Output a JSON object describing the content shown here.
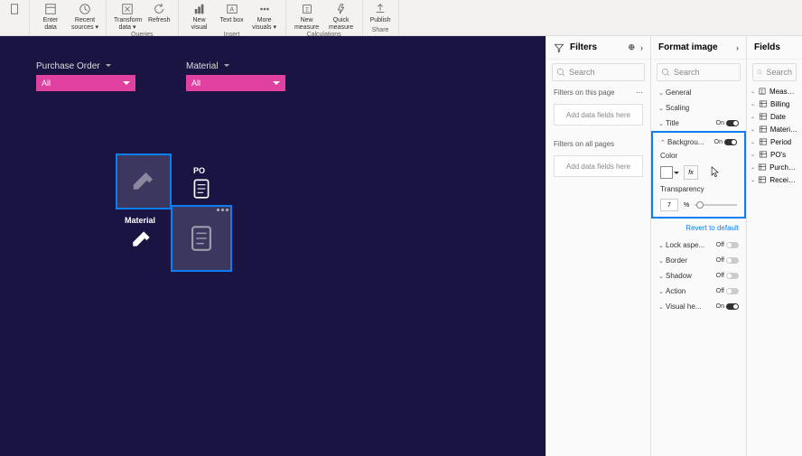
{
  "ribbon": {
    "groups": [
      {
        "label": "",
        "items": [
          {
            "label": ""
          }
        ]
      },
      {
        "label": "",
        "items": [
          {
            "label": "Enter data"
          },
          {
            "label": "Recent sources ▾"
          }
        ]
      },
      {
        "label": "Queries",
        "items": [
          {
            "label": "Transform data ▾"
          },
          {
            "label": "Refresh"
          }
        ]
      },
      {
        "label": "Insert",
        "items": [
          {
            "label": "New visual"
          },
          {
            "label": "Text box"
          },
          {
            "label": "More visuals ▾"
          }
        ]
      },
      {
        "label": "Calculations",
        "items": [
          {
            "label": "New measure"
          },
          {
            "label": "Quick measure"
          }
        ]
      },
      {
        "label": "Share",
        "items": [
          {
            "label": "Publish"
          }
        ]
      }
    ]
  },
  "canvas": {
    "slicers": [
      {
        "title": "Purchase Order",
        "value": "All"
      },
      {
        "title": "Material",
        "value": "All"
      }
    ],
    "labels": {
      "po": "PO",
      "material": "Material"
    }
  },
  "filters": {
    "title": "Filters",
    "search": "Search",
    "sec1": "Filters on this page",
    "drop1": "Add data fields here",
    "sec2": "Filters on all pages",
    "drop2": "Add data fields here"
  },
  "format": {
    "title": "Format image",
    "search": "Search",
    "sections": {
      "general": {
        "label": "General"
      },
      "scaling": {
        "label": "Scaling"
      },
      "title": {
        "label": "Title",
        "state": "On"
      },
      "background": {
        "label": "Backgrou...",
        "state": "On"
      },
      "color_label": "Color",
      "transparency_label": "Transparency",
      "transparency_value": "7",
      "transparency_pct": "%",
      "fx": "fx",
      "revert": "Revert to default",
      "lock": {
        "label": "Lock aspe...",
        "state": "Off"
      },
      "border": {
        "label": "Border",
        "state": "Off"
      },
      "shadow": {
        "label": "Shadow",
        "state": "Off"
      },
      "action": {
        "label": "Action",
        "state": "Off"
      },
      "visualhe": {
        "label": "Visual he...",
        "state": "On"
      }
    }
  },
  "fields": {
    "title": "Fields",
    "search": "Search",
    "tables": [
      {
        "label": "Measures U"
      },
      {
        "label": "Billing"
      },
      {
        "label": "Date"
      },
      {
        "label": "Materials"
      },
      {
        "label": "Period"
      },
      {
        "label": "PO's"
      },
      {
        "label": "Purchases"
      },
      {
        "label": "Receiving"
      }
    ]
  }
}
